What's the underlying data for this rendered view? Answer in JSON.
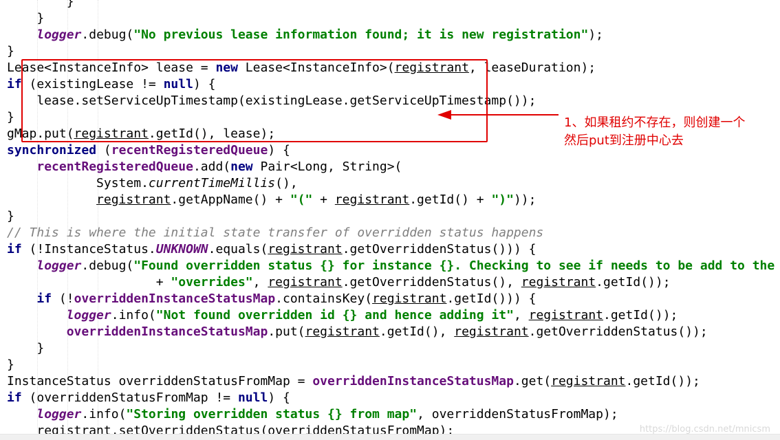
{
  "editor": {
    "lines": [
      "        }",
      "    }",
      "    logger.debug(\"No previous lease information found; it is new registration\");",
      "}",
      "Lease<InstanceInfo> lease = new Lease<InstanceInfo>(registrant, leaseDuration);",
      "if (existingLease != null) {",
      "    lease.setServiceUpTimestamp(existingLease.getServiceUpTimestamp());",
      "}",
      "gMap.put(registrant.getId(), lease);",
      "synchronized (recentRegisteredQueue) {",
      "    recentRegisteredQueue.add(new Pair<Long, String>(",
      "            System.currentTimeMillis(),",
      "            registrant.getAppName() + \"(\" + registrant.getId() + \")\"));",
      "}",
      "// This is where the initial state transfer of overridden status happens",
      "if (!InstanceStatus.UNKNOWN.equals(registrant.getOverriddenStatus())) {",
      "    logger.debug(\"Found overridden status {} for instance {}. Checking to see if needs to be add to the \"",
      "                    + \"overrides\", registrant.getOverriddenStatus(), registrant.getId());",
      "    if (!overriddenInstanceStatusMap.containsKey(registrant.getId())) {",
      "        logger.info(\"Not found overridden id {} and hence adding it\", registrant.getId());",
      "        overriddenInstanceStatusMap.put(registrant.getId(), registrant.getOverriddenStatus());",
      "    }",
      "}",
      "InstanceStatus overriddenStatusFromMap = overriddenInstanceStatusMap.get(registrant.getId());",
      "if (overriddenStatusFromMap != null) {",
      "    logger.info(\"Storing overridden status {} from map\", overriddenStatusFromMap);",
      "    registrant.setOverriddenStatus(overriddenStatusFromMap);"
    ]
  },
  "annotation": {
    "line1": "1、如果租约不存在，则创建一个",
    "line2": "然后put到注册中心去",
    "color": "#e00000"
  },
  "watermark": "https://blog.csdn.net/mnicsm",
  "colors": {
    "keyword": "#000080",
    "string": "#008000",
    "field": "#660e7a",
    "comment": "#808080"
  }
}
